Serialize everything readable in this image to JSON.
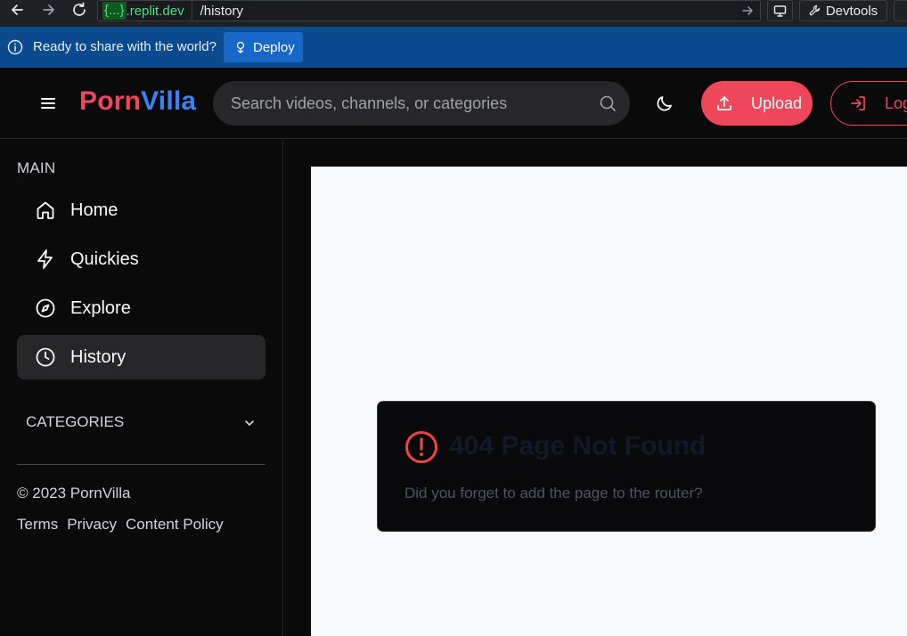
{
  "browser": {
    "url_badge": "{...}",
    "url_domain": ".replit.dev",
    "url_path": "/history",
    "devtools_label": "Devtools"
  },
  "notice": {
    "text": "Ready to share with the world?",
    "deploy_label": "Deploy"
  },
  "header": {
    "logo_part1": "Porn",
    "logo_part2": "Villa",
    "search_placeholder": "Search videos, channels, or categories",
    "upload_label": "Upload",
    "login_label": "Log"
  },
  "sidebar": {
    "section_main": "MAIN",
    "items": [
      {
        "label": "Home",
        "icon": "home-icon"
      },
      {
        "label": "Quickies",
        "icon": "lightning-icon"
      },
      {
        "label": "Explore",
        "icon": "compass-icon"
      },
      {
        "label": "History",
        "icon": "clock-icon",
        "active": true
      }
    ],
    "categories_label": "CATEGORIES",
    "copyright": "© 2023 PornVilla",
    "footer_links": [
      "Terms",
      "Privacy",
      "Content Policy"
    ]
  },
  "error": {
    "title": "404 Page Not Found",
    "message": "Did you forget to add the page to the router?"
  },
  "colors": {
    "brand_red": "#f0465a",
    "brand_blue": "#3b82f6",
    "info_bar": "#0b4a8f",
    "deploy_button": "#1567c8"
  }
}
